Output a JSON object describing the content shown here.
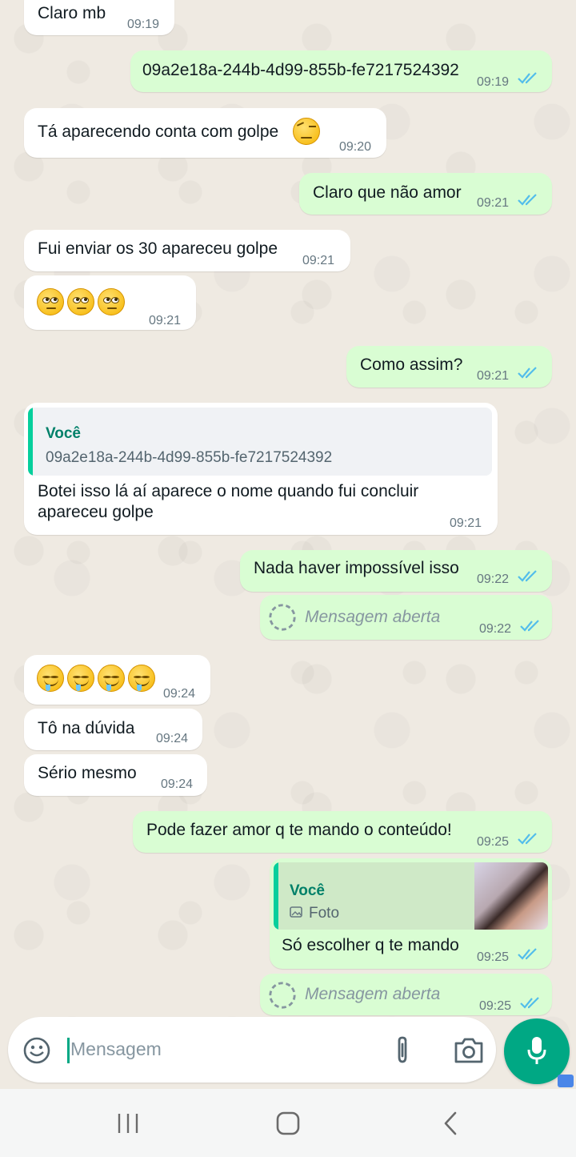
{
  "messages": {
    "m1": {
      "text": "Claro mb",
      "time": "09:19"
    },
    "m2": {
      "text": "09a2e18a-244b-4d99-855b-fe7217524392",
      "time": "09:19"
    },
    "m3": {
      "text": "Tá aparecendo conta com golpe",
      "time": "09:20"
    },
    "m4": {
      "text": "Claro que não amor",
      "time": "09:21"
    },
    "m5": {
      "text": "Fui enviar os 30 apareceu golpe",
      "time": "09:21"
    },
    "m6": {
      "time": "09:21",
      "emoji": "face-with-rolling-eyes x3"
    },
    "m7": {
      "text": "Como assim?",
      "time": "09:21"
    },
    "m8": {
      "quote_name": "Você",
      "quote_text": "09a2e18a-244b-4d99-855b-fe7217524392",
      "line1": "Botei isso lá aí aparece o nome quando fui concluir",
      "line2": "apareceu golpe",
      "time": "09:21"
    },
    "m9": {
      "text": "Nada haver impossível isso",
      "time": "09:22"
    },
    "m10": {
      "text": "Mensagem aberta",
      "time": "09:22"
    },
    "m11": {
      "time": "09:24",
      "emoji": "drooling-face x4"
    },
    "m12": {
      "text": "Tô na dúvida",
      "time": "09:24"
    },
    "m13": {
      "text": "Sério mesmo",
      "time": "09:24"
    },
    "m14": {
      "text": "Pode fazer amor q te mando o conteúdo!",
      "time": "09:25"
    },
    "m15": {
      "quote_name": "Você",
      "quote_text": "Foto",
      "text": "Só escolher q te mando",
      "time": "09:25"
    },
    "m16": {
      "text": "Mensagem aberta",
      "time": "09:25"
    }
  },
  "composer": {
    "placeholder": "Mensagem"
  },
  "icons": {
    "emoji": "emoji-icon",
    "attach": "paperclip-icon",
    "camera": "camera-icon",
    "mic": "mic-icon",
    "read_ticks": "double-check-icon",
    "view_once": "view-once-icon"
  },
  "colors": {
    "incoming": "#ffffff",
    "outgoing": "#d9fdd3",
    "accent": "#00a884",
    "read_tick": "#53bdeb",
    "quote_bar": "#06cf9c",
    "background": "#efeae2"
  }
}
